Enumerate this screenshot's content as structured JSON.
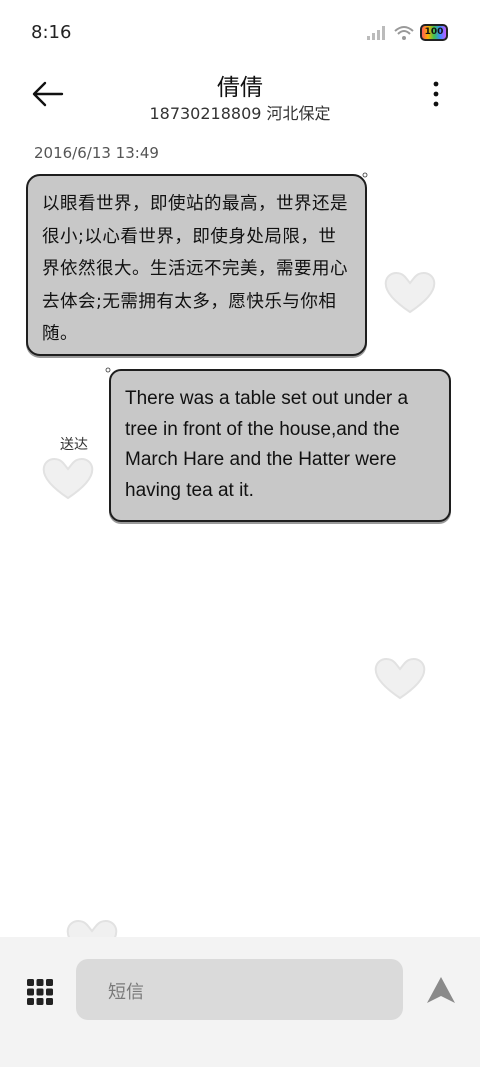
{
  "status_bar": {
    "time": "8:16",
    "battery": "100",
    "signal_icon": "signal-icon",
    "wifi_icon": "wifi-icon"
  },
  "header": {
    "contact_name": "倩倩",
    "contact_subtitle": "18730218809 河北保定",
    "back_icon": "back-arrow-icon",
    "more_icon": "more-vertical-icon"
  },
  "conversation": {
    "timestamp": "2016/6/13 13:49",
    "messages": [
      {
        "direction": "incoming",
        "text": "以眼看世界，即使站的最高，世界还是很小;以心看世界，即使身处局限，世界依然很大。生活远不完美，需要用心去体会;无需拥有太多，愿快乐与你相随。"
      },
      {
        "direction": "outgoing",
        "text": "There was a table set out under a tree in front of the house,and the March Hare and the Hatter were having tea at it.",
        "status": "送达"
      }
    ]
  },
  "composer": {
    "placeholder": "短信",
    "apps_icon": "grid-apps-icon",
    "send_icon": "send-icon"
  },
  "colors": {
    "bubble": "#c8c8c8",
    "bubble_border": "#1e1e1e",
    "input_bg": "#dadada",
    "bottom_bar_bg": "#f3f3f3"
  }
}
